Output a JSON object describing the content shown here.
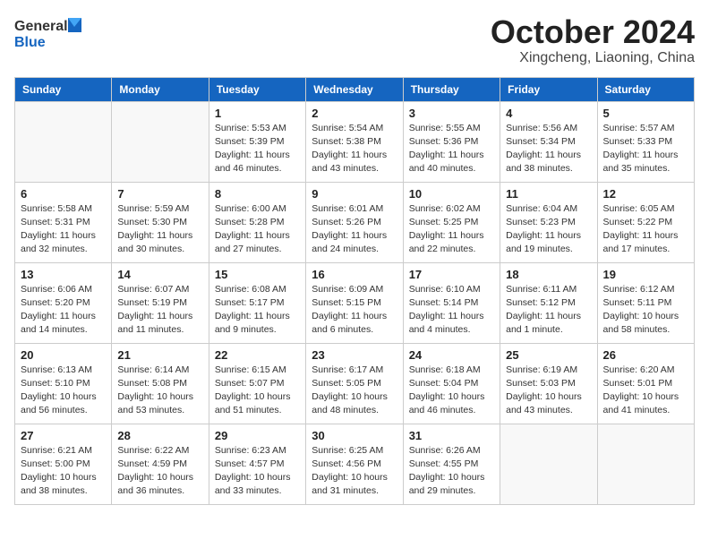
{
  "logo": {
    "general": "General",
    "blue": "Blue"
  },
  "header": {
    "month": "October 2024",
    "location": "Xingcheng, Liaoning, China"
  },
  "weekdays": [
    "Sunday",
    "Monday",
    "Tuesday",
    "Wednesday",
    "Thursday",
    "Friday",
    "Saturday"
  ],
  "weeks": [
    [
      {
        "day": "",
        "info": ""
      },
      {
        "day": "",
        "info": ""
      },
      {
        "day": "1",
        "info": "Sunrise: 5:53 AM\nSunset: 5:39 PM\nDaylight: 11 hours and 46 minutes."
      },
      {
        "day": "2",
        "info": "Sunrise: 5:54 AM\nSunset: 5:38 PM\nDaylight: 11 hours and 43 minutes."
      },
      {
        "day": "3",
        "info": "Sunrise: 5:55 AM\nSunset: 5:36 PM\nDaylight: 11 hours and 40 minutes."
      },
      {
        "day": "4",
        "info": "Sunrise: 5:56 AM\nSunset: 5:34 PM\nDaylight: 11 hours and 38 minutes."
      },
      {
        "day": "5",
        "info": "Sunrise: 5:57 AM\nSunset: 5:33 PM\nDaylight: 11 hours and 35 minutes."
      }
    ],
    [
      {
        "day": "6",
        "info": "Sunrise: 5:58 AM\nSunset: 5:31 PM\nDaylight: 11 hours and 32 minutes."
      },
      {
        "day": "7",
        "info": "Sunrise: 5:59 AM\nSunset: 5:30 PM\nDaylight: 11 hours and 30 minutes."
      },
      {
        "day": "8",
        "info": "Sunrise: 6:00 AM\nSunset: 5:28 PM\nDaylight: 11 hours and 27 minutes."
      },
      {
        "day": "9",
        "info": "Sunrise: 6:01 AM\nSunset: 5:26 PM\nDaylight: 11 hours and 24 minutes."
      },
      {
        "day": "10",
        "info": "Sunrise: 6:02 AM\nSunset: 5:25 PM\nDaylight: 11 hours and 22 minutes."
      },
      {
        "day": "11",
        "info": "Sunrise: 6:04 AM\nSunset: 5:23 PM\nDaylight: 11 hours and 19 minutes."
      },
      {
        "day": "12",
        "info": "Sunrise: 6:05 AM\nSunset: 5:22 PM\nDaylight: 11 hours and 17 minutes."
      }
    ],
    [
      {
        "day": "13",
        "info": "Sunrise: 6:06 AM\nSunset: 5:20 PM\nDaylight: 11 hours and 14 minutes."
      },
      {
        "day": "14",
        "info": "Sunrise: 6:07 AM\nSunset: 5:19 PM\nDaylight: 11 hours and 11 minutes."
      },
      {
        "day": "15",
        "info": "Sunrise: 6:08 AM\nSunset: 5:17 PM\nDaylight: 11 hours and 9 minutes."
      },
      {
        "day": "16",
        "info": "Sunrise: 6:09 AM\nSunset: 5:15 PM\nDaylight: 11 hours and 6 minutes."
      },
      {
        "day": "17",
        "info": "Sunrise: 6:10 AM\nSunset: 5:14 PM\nDaylight: 11 hours and 4 minutes."
      },
      {
        "day": "18",
        "info": "Sunrise: 6:11 AM\nSunset: 5:12 PM\nDaylight: 11 hours and 1 minute."
      },
      {
        "day": "19",
        "info": "Sunrise: 6:12 AM\nSunset: 5:11 PM\nDaylight: 10 hours and 58 minutes."
      }
    ],
    [
      {
        "day": "20",
        "info": "Sunrise: 6:13 AM\nSunset: 5:10 PM\nDaylight: 10 hours and 56 minutes."
      },
      {
        "day": "21",
        "info": "Sunrise: 6:14 AM\nSunset: 5:08 PM\nDaylight: 10 hours and 53 minutes."
      },
      {
        "day": "22",
        "info": "Sunrise: 6:15 AM\nSunset: 5:07 PM\nDaylight: 10 hours and 51 minutes."
      },
      {
        "day": "23",
        "info": "Sunrise: 6:17 AM\nSunset: 5:05 PM\nDaylight: 10 hours and 48 minutes."
      },
      {
        "day": "24",
        "info": "Sunrise: 6:18 AM\nSunset: 5:04 PM\nDaylight: 10 hours and 46 minutes."
      },
      {
        "day": "25",
        "info": "Sunrise: 6:19 AM\nSunset: 5:03 PM\nDaylight: 10 hours and 43 minutes."
      },
      {
        "day": "26",
        "info": "Sunrise: 6:20 AM\nSunset: 5:01 PM\nDaylight: 10 hours and 41 minutes."
      }
    ],
    [
      {
        "day": "27",
        "info": "Sunrise: 6:21 AM\nSunset: 5:00 PM\nDaylight: 10 hours and 38 minutes."
      },
      {
        "day": "28",
        "info": "Sunrise: 6:22 AM\nSunset: 4:59 PM\nDaylight: 10 hours and 36 minutes."
      },
      {
        "day": "29",
        "info": "Sunrise: 6:23 AM\nSunset: 4:57 PM\nDaylight: 10 hours and 33 minutes."
      },
      {
        "day": "30",
        "info": "Sunrise: 6:25 AM\nSunset: 4:56 PM\nDaylight: 10 hours and 31 minutes."
      },
      {
        "day": "31",
        "info": "Sunrise: 6:26 AM\nSunset: 4:55 PM\nDaylight: 10 hours and 29 minutes."
      },
      {
        "day": "",
        "info": ""
      },
      {
        "day": "",
        "info": ""
      }
    ]
  ]
}
